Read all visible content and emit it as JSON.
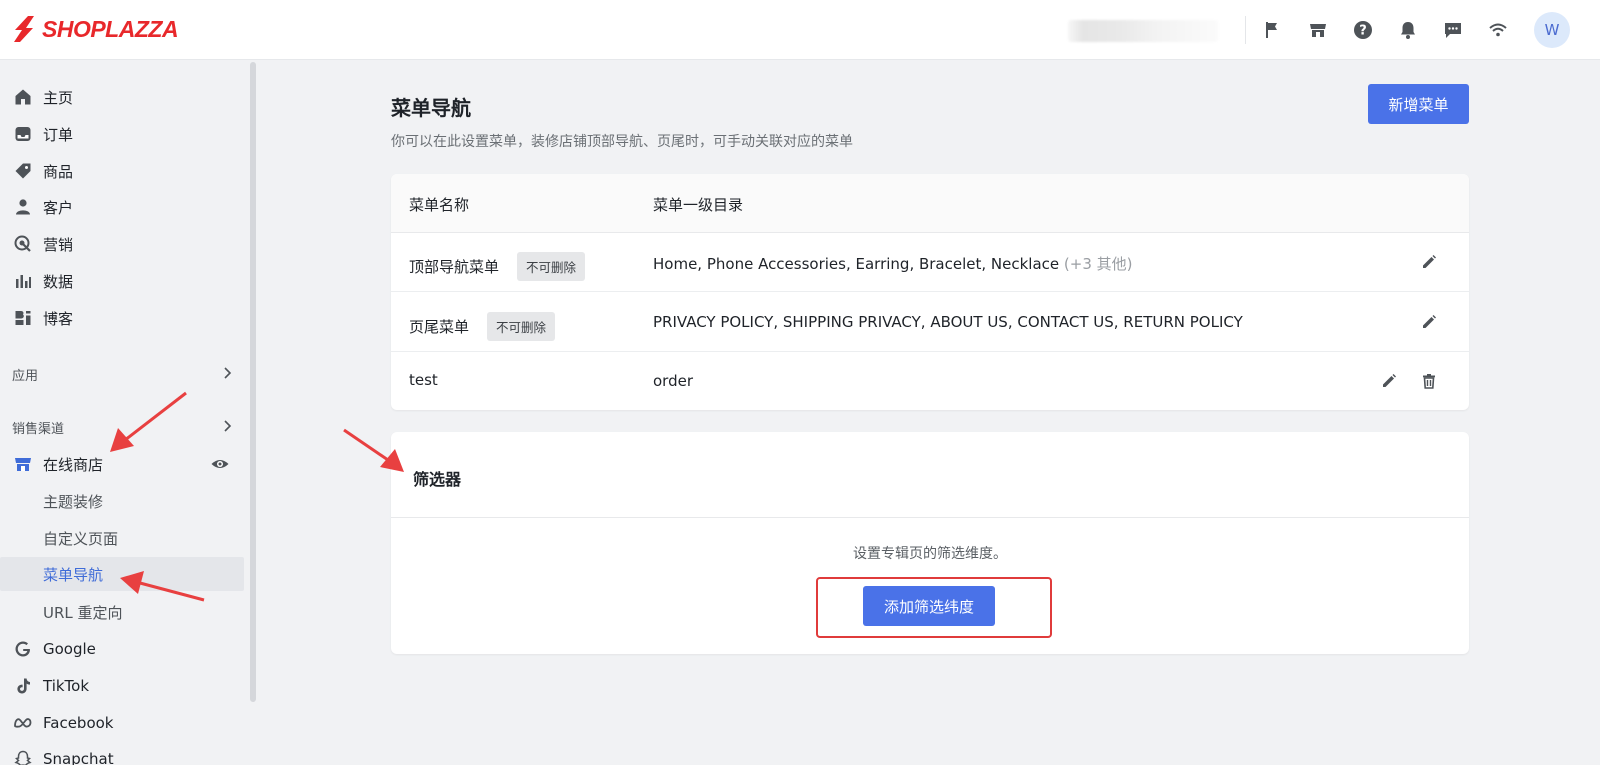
{
  "brand": {
    "name": "SHOPLAZZA",
    "color": "#e8282b"
  },
  "header": {
    "icons": [
      "flag-icon",
      "store-icon",
      "help-icon",
      "bell-icon",
      "message-icon",
      "wifi-icon"
    ],
    "avatar_initial": "W"
  },
  "sidebar": {
    "main_items": [
      {
        "label": "主页",
        "icon": "home-icon"
      },
      {
        "label": "订单",
        "icon": "inbox-icon"
      },
      {
        "label": "商品",
        "icon": "tag-icon"
      },
      {
        "label": "客户",
        "icon": "person-icon"
      },
      {
        "label": "营销",
        "icon": "target-icon"
      },
      {
        "label": "数据",
        "icon": "bar-chart-icon"
      },
      {
        "label": "博客",
        "icon": "blog-icon"
      }
    ],
    "apps_label": "应用",
    "channels_label": "销售渠道",
    "online_store": {
      "label": "在线商店",
      "icon": "store-icon"
    },
    "sub_items": [
      {
        "label": "主题装修"
      },
      {
        "label": "自定义页面"
      },
      {
        "label": "菜单导航",
        "active": true
      },
      {
        "label": "URL 重定向"
      }
    ],
    "channel_items": [
      {
        "label": "Google",
        "icon": "google-icon"
      },
      {
        "label": "TikTok",
        "icon": "tiktok-icon"
      },
      {
        "label": "Facebook",
        "icon": "meta-icon"
      },
      {
        "label": "Snapchat",
        "icon": "snapchat-icon"
      }
    ]
  },
  "main": {
    "title": "菜单导航",
    "subtitle": "你可以在此设置菜单，装修店铺顶部导航、页尾时，可手动关联对应的菜单",
    "new_button": "新增菜单",
    "table": {
      "headers": [
        "菜单名称",
        "菜单一级目录"
      ],
      "rows": [
        {
          "name": "顶部导航菜单",
          "badge": "不可删除",
          "items": "Home, Phone Accessories, Earring, Bracelet, Necklace",
          "more": "(+3 其他)"
        },
        {
          "name": "页尾菜单",
          "badge": "不可删除",
          "items": "PRIVACY POLICY, SHIPPING PRIVACY, ABOUT US, CONTACT US, RETURN POLICY",
          "more": ""
        },
        {
          "name": "test",
          "badge": "",
          "items": "order",
          "more": ""
        }
      ]
    },
    "filter": {
      "title": "筛选器",
      "description": "设置专辑页的筛选维度。",
      "button": "添加筛选纬度"
    }
  },
  "colors": {
    "primary": "#4a72e8",
    "active_text": "#3f6cd8",
    "annotation": "#e84040"
  }
}
